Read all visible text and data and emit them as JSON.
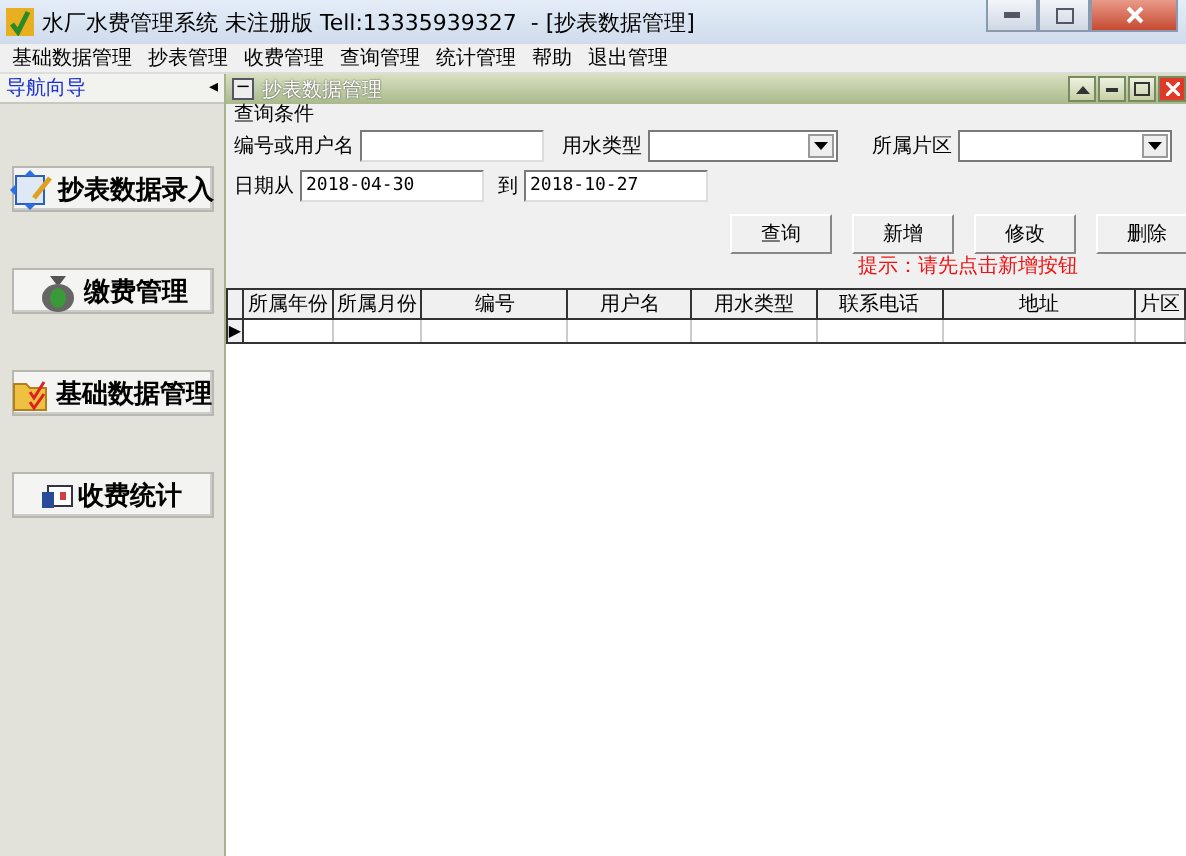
{
  "window": {
    "title": "水厂水费管理系统 未注册版 Tell:13335939327  - [抄表数据管理]"
  },
  "menu": [
    "基础数据管理",
    "抄表管理",
    "收费管理",
    "查询管理",
    "统计管理",
    "帮助",
    "退出管理"
  ],
  "sidebar": {
    "title": "导航向导",
    "collapse": "◂",
    "items": [
      {
        "label": "抄表数据录入",
        "kind": "meter"
      },
      {
        "label": "缴费管理",
        "kind": "money"
      },
      {
        "label": "基础数据管理",
        "kind": "folder"
      },
      {
        "label": "收费统计",
        "kind": "stats"
      }
    ]
  },
  "child_window": {
    "title": "抄表数据管理",
    "menu_glyph": "−"
  },
  "query": {
    "legend": "查询条件",
    "user_label": "编号或用户名",
    "type_label": "用水类型",
    "area_label": "所属片区",
    "date_from_label": "日期从",
    "date_from": "2018-04-30",
    "date_to_label": "到",
    "date_to": "2018-10-27",
    "buttons": [
      "查询",
      "新增",
      "修改",
      "删除"
    ],
    "hint": "提示：请先点击新增按钮"
  },
  "table": {
    "columns": [
      "所属年份",
      "所属月份",
      "编号",
      "用户名",
      "用水类型",
      "联系电话",
      "地址",
      "片区"
    ],
    "row_marker": "▶"
  }
}
